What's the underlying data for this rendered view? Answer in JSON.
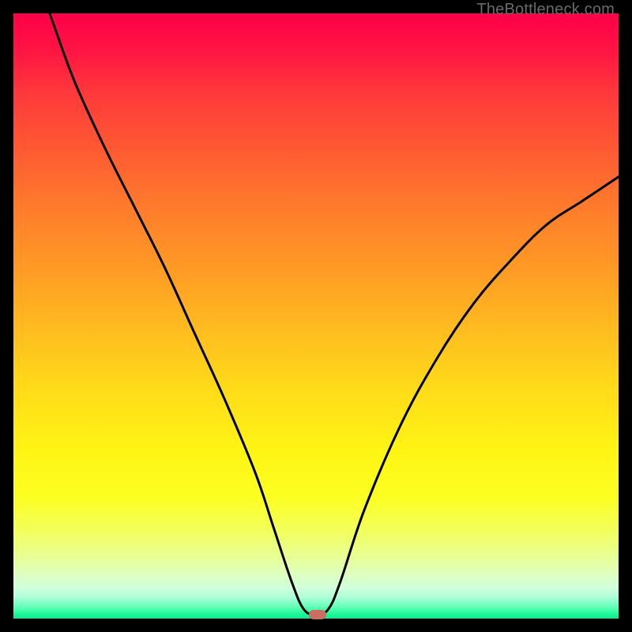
{
  "watermark": "TheBottleneck.com",
  "marker": {
    "x_pct": 50.3,
    "y_pct": 99.3
  },
  "chart_data": {
    "type": "line",
    "title": "",
    "xlabel": "",
    "ylabel": "",
    "xlim": [
      0,
      100
    ],
    "ylim": [
      0,
      100
    ],
    "grid": false,
    "legend": false,
    "series": [
      {
        "name": "bottleneck-curve",
        "x": [
          6,
          10,
          15,
          20,
          25,
          30,
          35,
          40,
          43,
          46,
          48,
          50,
          52,
          54,
          58,
          64,
          70,
          76,
          82,
          88,
          94,
          100
        ],
        "y": [
          100,
          89,
          78,
          68,
          58,
          47,
          36,
          24,
          15,
          6,
          1.5,
          0.7,
          1.5,
          6,
          18,
          32,
          43,
          52,
          59,
          65,
          69,
          73
        ]
      }
    ],
    "background_gradient": {
      "orientation": "vertical",
      "stops": [
        {
          "pct": 0,
          "color": "#ff0049"
        },
        {
          "pct": 32,
          "color": "#ff7b2c"
        },
        {
          "pct": 62,
          "color": "#ffdb19"
        },
        {
          "pct": 86,
          "color": "#f1ff62"
        },
        {
          "pct": 97,
          "color": "#7effc3"
        },
        {
          "pct": 100,
          "color": "#12e68d"
        }
      ]
    },
    "annotations": [
      {
        "type": "marker",
        "shape": "pill",
        "x": 50.3,
        "y": 0.7,
        "color": "#cb6e62"
      }
    ]
  }
}
